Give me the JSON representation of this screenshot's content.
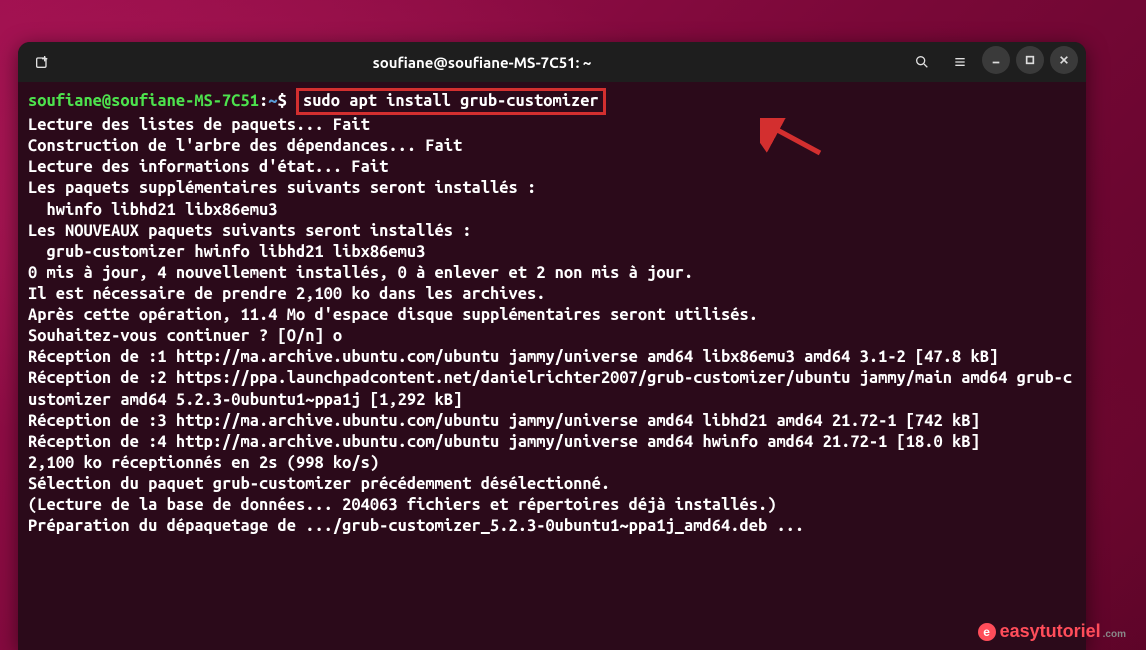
{
  "titlebar": {
    "title": "soufiane@soufiane-MS-7C51: ~"
  },
  "prompt": {
    "user": "soufiane@soufiane-MS-7C51",
    "path": "~",
    "symbol": "$",
    "command": "sudo apt install grub-customizer"
  },
  "output": {
    "l1": "Lecture des listes de paquets... Fait",
    "l2": "Construction de l'arbre des dépendances... Fait",
    "l3": "Lecture des informations d'état... Fait",
    "l4": "Les paquets supplémentaires suivants seront installés :",
    "l5": "  hwinfo libhd21 libx86emu3",
    "l6": "Les NOUVEAUX paquets suivants seront installés :",
    "l7": "  grub-customizer hwinfo libhd21 libx86emu3",
    "l8": "0 mis à jour, 4 nouvellement installés, 0 à enlever et 2 non mis à jour.",
    "l9": "Il est nécessaire de prendre 2,100 ko dans les archives.",
    "l10": "Après cette opération, 11.4 Mo d'espace disque supplémentaires seront utilisés.",
    "l11": "Souhaitez-vous continuer ? [O/n] o",
    "l12": "Réception de :1 http://ma.archive.ubuntu.com/ubuntu jammy/universe amd64 libx86emu3 amd64 3.1-2 [47.8 kB]",
    "l13": "Réception de :2 https://ppa.launchpadcontent.net/danielrichter2007/grub-customizer/ubuntu jammy/main amd64 grub-customizer amd64 5.2.3-0ubuntu1~ppa1j [1,292 kB]",
    "l14": "Réception de :3 http://ma.archive.ubuntu.com/ubuntu jammy/universe amd64 libhd21 amd64 21.72-1 [742 kB]",
    "l15": "Réception de :4 http://ma.archive.ubuntu.com/ubuntu jammy/universe amd64 hwinfo amd64 21.72-1 [18.0 kB]",
    "l16": "2,100 ko réceptionnés en 2s (998 ko/s)",
    "l17": "Sélection du paquet grub-customizer précédemment désélectionné.",
    "l18": "(Lecture de la base de données... 204063 fichiers et répertoires déjà installés.)",
    "l19": "Préparation du dépaquetage de .../grub-customizer_5.2.3-0ubuntu1~ppa1j_amd64.deb ..."
  },
  "watermark": {
    "text": "easytutoriel",
    "suffix": ".com"
  }
}
